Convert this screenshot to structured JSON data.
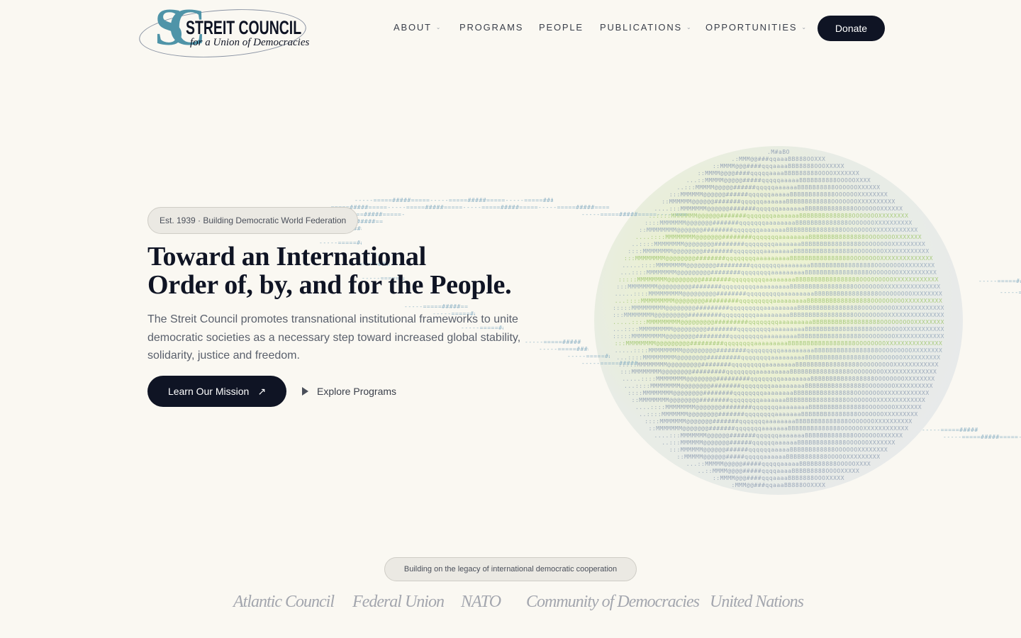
{
  "header": {
    "logo": {
      "mark": "SC",
      "title": "STREIT COUNCIL",
      "subtitle": "for a Union of Democracies"
    },
    "nav": [
      {
        "label": "ABOUT",
        "has_dropdown": true
      },
      {
        "label": "PROGRAMS",
        "has_dropdown": false
      },
      {
        "label": "PEOPLE",
        "has_dropdown": false
      },
      {
        "label": "PUBLICATIONS",
        "has_dropdown": true
      },
      {
        "label": "OPPORTUNITIES",
        "has_dropdown": true
      }
    ],
    "donate_label": "Donate"
  },
  "hero": {
    "eyebrow": "Est. 1939 · Building Democratic World Federation",
    "title_line1": "Toward an International",
    "title_line2": "Order of, by, and for the People.",
    "text": "The Streit Council promotes transnational institutional frameworks to unite democratic societies as a necessary step toward increased global stability, solidarity, justice and freedom.",
    "primary_cta": "Learn Our Mission",
    "secondary_cta": "Explore Programs"
  },
  "legacy": {
    "pill": "Building on the legacy of international democratic cooperation",
    "organizations": [
      "Atlantic Council",
      "Federal Union",
      "NATO",
      "Community of Democracies",
      "United Nations"
    ]
  },
  "colors": {
    "background": "#faf8f2",
    "navy": "#0f1424",
    "logo_teal": "#4f94a8",
    "ascii_blue": "#8fb3c6",
    "ascii_green": "#a6cf6a"
  },
  "icons": {
    "chevron": "chevron-down-icon",
    "arrow": "arrow-up-right-icon",
    "play": "play-icon"
  }
}
